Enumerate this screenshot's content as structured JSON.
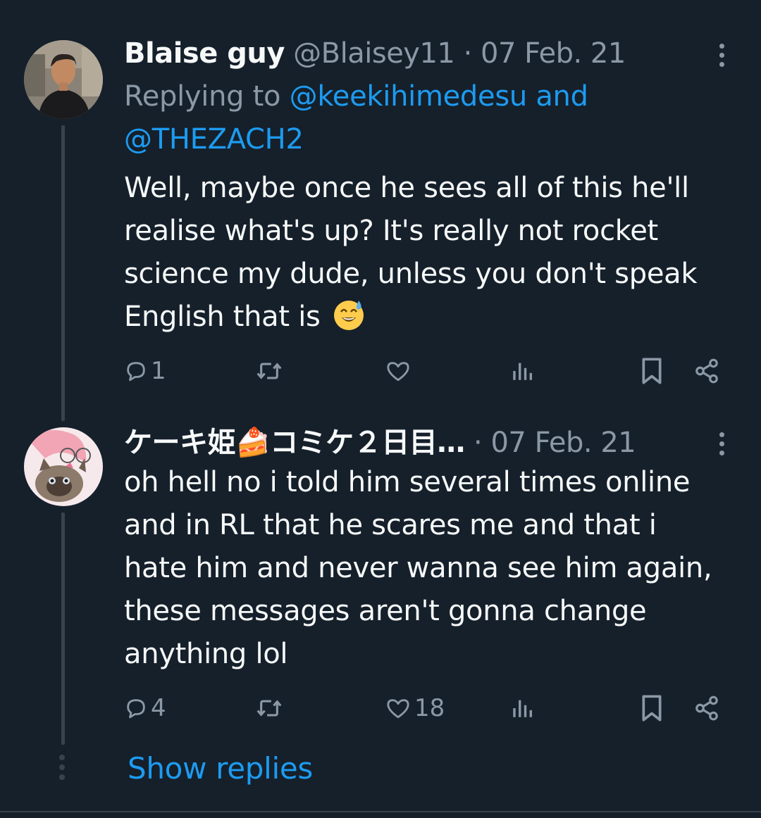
{
  "tweets": [
    {
      "name": "Blaise guy",
      "handle": "@Blaisey11",
      "separator": "·",
      "date": "07 Feb. 21",
      "replying_prefix": "Replying to",
      "replying_to": "@keekihimedesu and",
      "replying_to_2": "@THEZACH2",
      "text_lines": [
        "Well, maybe once he sees all of this he'll",
        "realise what's up? It's really not rocket",
        "science my dude, unless you don't speak",
        "English that is"
      ],
      "emoji": "grinning-face-with-sweat",
      "actions": {
        "reply_count": "1",
        "retweet_count": "",
        "like_count": "",
        "views_count": ""
      }
    },
    {
      "name": "ケーキ姫🍰コミケ２日目…",
      "separator": "·",
      "date": "07 Feb. 21",
      "text_lines": [
        "oh hell no i told him several times online",
        "and in RL that he scares me and that i",
        "hate him and never wanna see him again,",
        "these messages aren't gonna change",
        "anything lol"
      ],
      "actions": {
        "reply_count": "4",
        "retweet_count": "",
        "like_count": "18",
        "views_count": ""
      }
    }
  ],
  "show_replies_label": "Show replies",
  "colors": {
    "background": "#15202b",
    "text": "#f7f9f9",
    "muted": "#8b98a5",
    "link": "#1d9bf0",
    "line": "#38444d"
  },
  "icons": {
    "reply": "reply-icon",
    "retweet": "retweet-icon",
    "like": "heart-icon",
    "views": "views-icon",
    "bookmark": "bookmark-icon",
    "share": "share-icon",
    "more": "more-options-icon"
  }
}
